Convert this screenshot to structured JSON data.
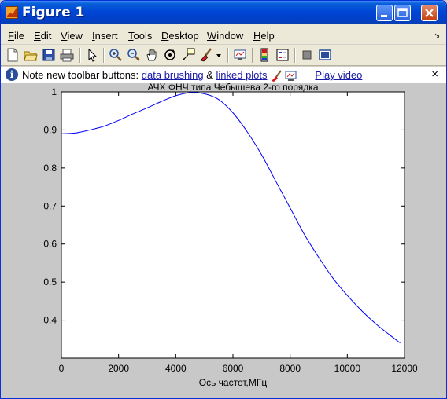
{
  "window": {
    "title": "Figure 1",
    "title_icon": "matlab-logo-icon",
    "controls": [
      "minimize-icon",
      "maximize-icon",
      "close-icon"
    ]
  },
  "menu": {
    "items": [
      "File",
      "Edit",
      "View",
      "Insert",
      "Tools",
      "Desktop",
      "Window",
      "Help"
    ],
    "dock_arrow": "↘"
  },
  "toolbar": {
    "icons": [
      "new-figure-icon",
      "open-file-icon",
      "save-icon",
      "print-icon",
      "pointer-icon",
      "zoom-in-icon",
      "zoom-out-icon",
      "pan-icon",
      "rotate-3d-icon",
      "data-cursor-icon",
      "brush-icon",
      "brush-dropdown-icon",
      "link-plot-icon",
      "colorbar-icon",
      "legend-icon",
      "hide-plot-tools-icon",
      "show-plot-tools-icon"
    ]
  },
  "infobar": {
    "prefix": "Note new toolbar buttons:",
    "link1": "data brushing",
    "amp": "&",
    "link2": "linked plots",
    "link3": "Play video",
    "close": "×"
  },
  "chart_data": {
    "type": "line",
    "title": "АЧХ ФНЧ типа Чебышева 2-го порядка",
    "xlabel": "Ось частот,МГц",
    "ylabel": "",
    "xlim": [
      0,
      12000
    ],
    "ylim": [
      0.3,
      1.0
    ],
    "xticks": [
      "0",
      "2000",
      "4000",
      "6000",
      "8000",
      "10000",
      "12000"
    ],
    "yticks": [
      "0.4",
      "0.5",
      "0.6",
      "0.7",
      "0.8",
      "0.9",
      "1"
    ],
    "line_color": "#0000ff",
    "grid": false,
    "series": [
      {
        "x": [
          0,
          500,
          1000,
          1500,
          2000,
          2500,
          3000,
          3500,
          4000,
          4500,
          5000,
          5500,
          6000,
          6500,
          7000,
          7500,
          8000,
          8500,
          9000,
          9500,
          10000,
          10500,
          11000,
          11500,
          11850
        ],
        "y": [
          0.89,
          0.892,
          0.9,
          0.91,
          0.925,
          0.942,
          0.958,
          0.975,
          0.99,
          0.998,
          0.995,
          0.98,
          0.945,
          0.895,
          0.835,
          0.765,
          0.695,
          0.625,
          0.565,
          0.51,
          0.465,
          0.425,
          0.39,
          0.36,
          0.34
        ]
      }
    ]
  }
}
